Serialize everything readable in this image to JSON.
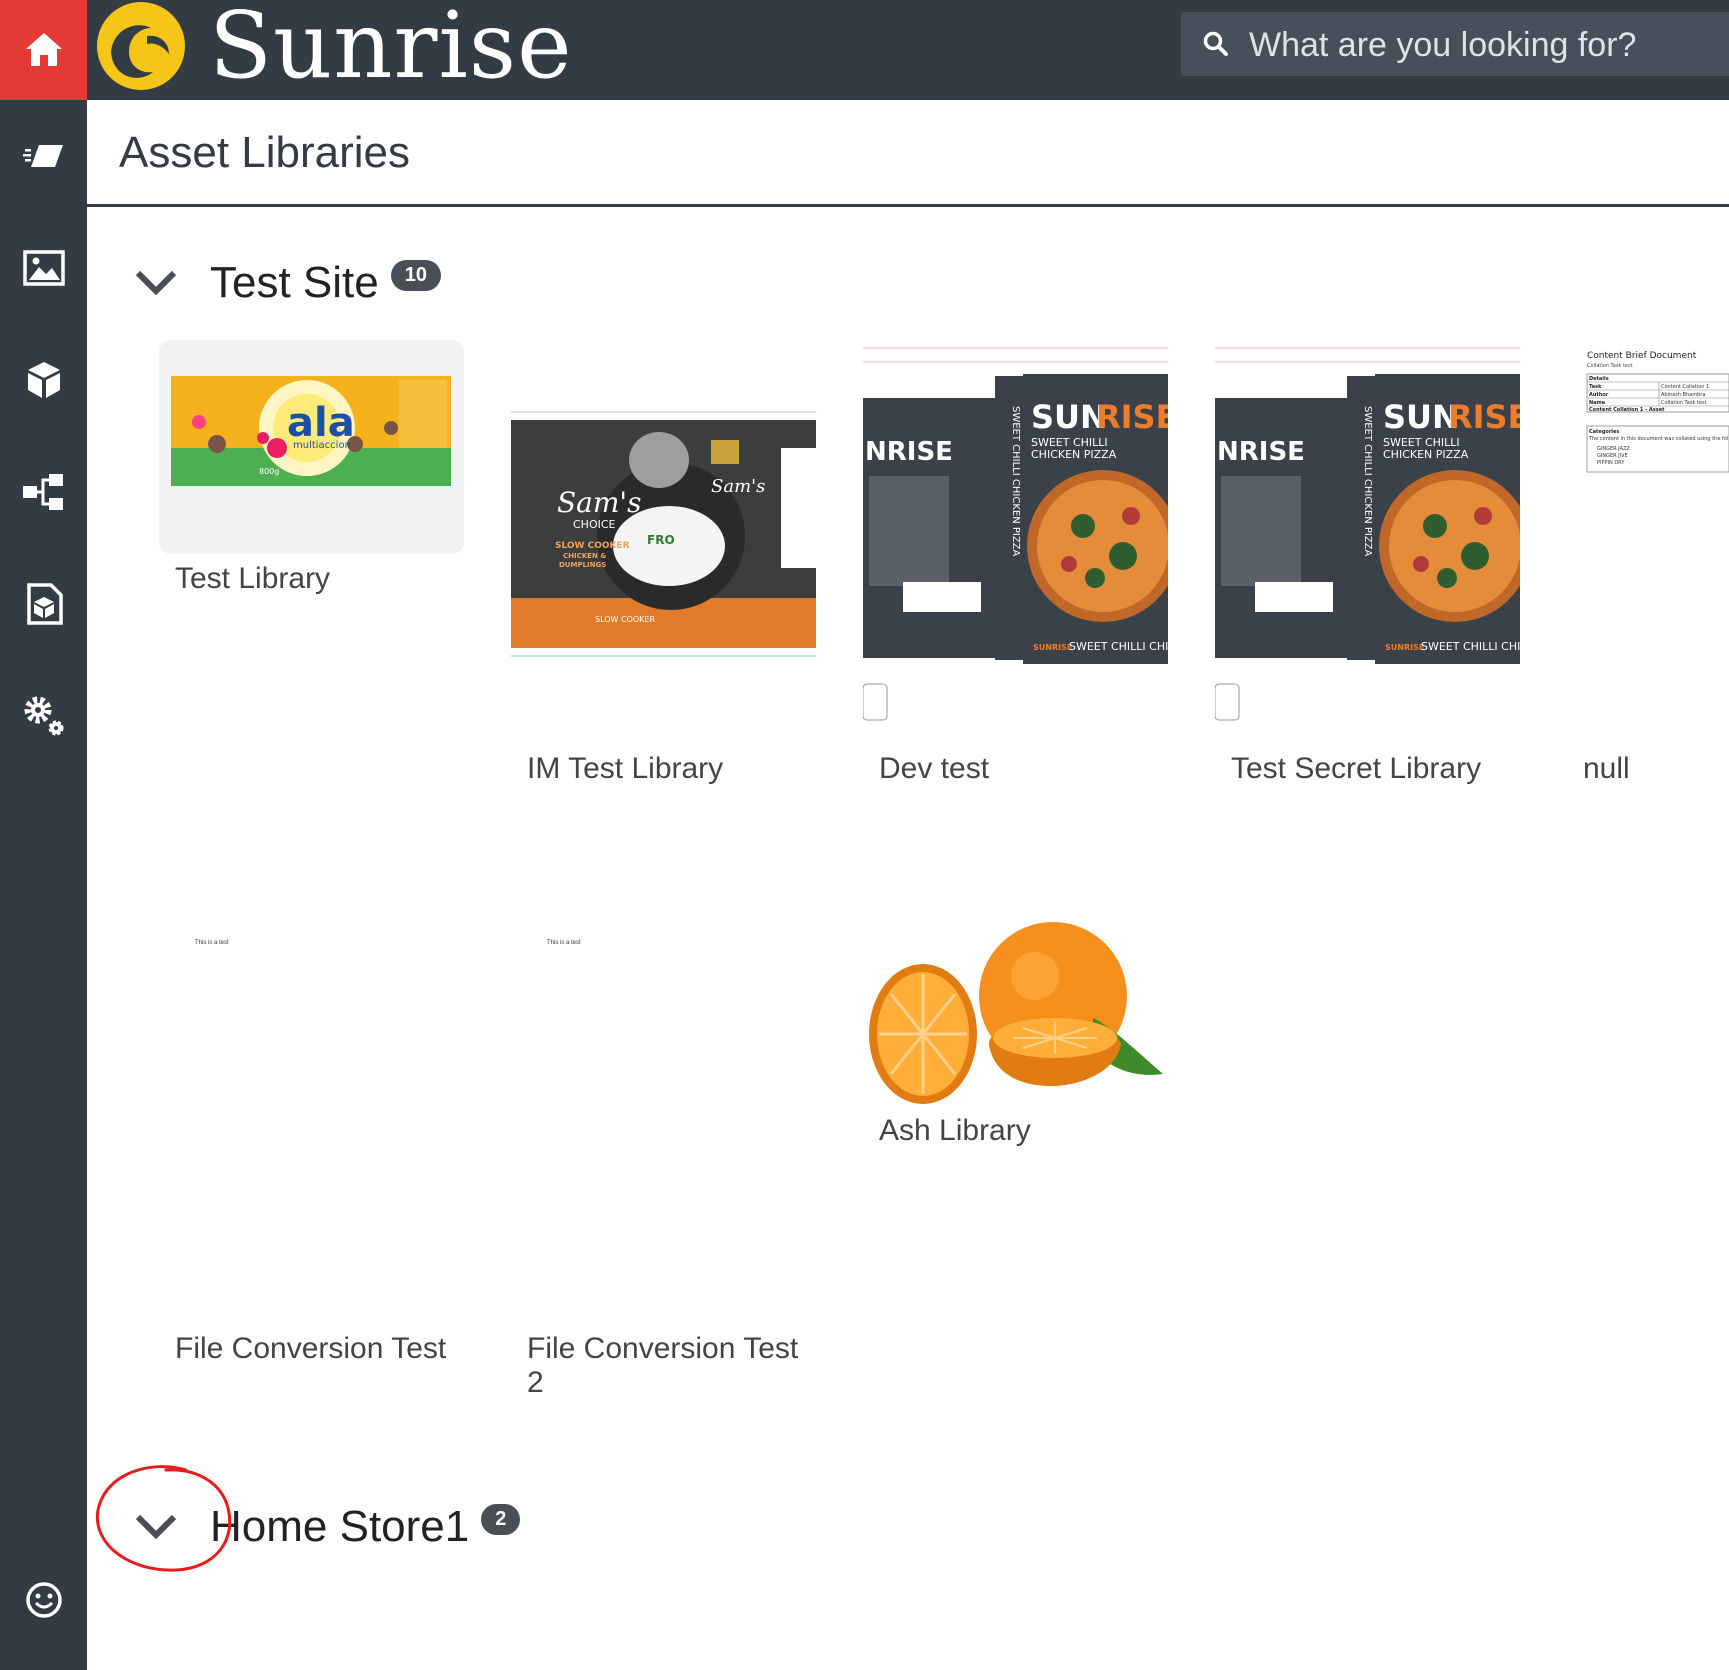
{
  "app": {
    "brand": "Sunrise"
  },
  "search": {
    "placeholder": "What are you looking for?"
  },
  "page": {
    "title": "Asset Libraries"
  },
  "groups": [
    {
      "title": "Test Site",
      "count": "10",
      "libraries": [
        {
          "label": "Test Library"
        },
        {
          "label": "IM Test Library"
        },
        {
          "label": "Dev test"
        },
        {
          "label": "Test Secret Library"
        },
        {
          "label": "null"
        },
        {
          "label": "File Conversion Test"
        },
        {
          "label": "File Conversion Test 2"
        },
        {
          "label": "Ash Library"
        }
      ]
    },
    {
      "title": "Home Store1",
      "count": "2"
    }
  ],
  "thumbnails": {
    "ala": {
      "brand": "ala",
      "sub": "multiaccion",
      "weight": "800g"
    },
    "sams": {
      "brand": "Sam's",
      "choice": "CHOICE",
      "line1": "SLOW COOKER",
      "line2": "CHICKEN &",
      "line3": "DUMPLINGS",
      "footer": "SLOW COOKER",
      "badge": "FRO"
    },
    "sunrise_box": {
      "brand_left": "NRISE",
      "brand_sun": "SUN",
      "brand_rise": "RISE",
      "product1": "SWEET CHILLI",
      "product2": "CHICKEN PIZZA",
      "spine": "SWEET CHILLI CHICKEN PIZZA",
      "footer": "SWEET CHILLI CHICK",
      "footer_brand": "SUNRISE"
    },
    "brief": {
      "title": "Content Brief Document",
      "subtitle": "Collation Task test",
      "details": "Details",
      "task": "Task",
      "author": "Author",
      "name": "Name",
      "task_val": "Content Collation 1",
      "author_val": "Abinash Bhambra",
      "name_val": "Collation Task test",
      "row4": "Content Collation 1 - Asset",
      "categories": "Categories",
      "cat_text": "The content in this document was collated using the fol",
      "item1": "GINGER JAZZ",
      "item2": "GINGER JIVE",
      "item3": "PIPPIN DRY"
    },
    "text_doc": {
      "text": "This is a test"
    }
  },
  "colors": {
    "sidebar": "#333c45",
    "home": "#e53935",
    "logo_yellow": "#f5c518",
    "pizza_orange": "#f07b2a"
  }
}
